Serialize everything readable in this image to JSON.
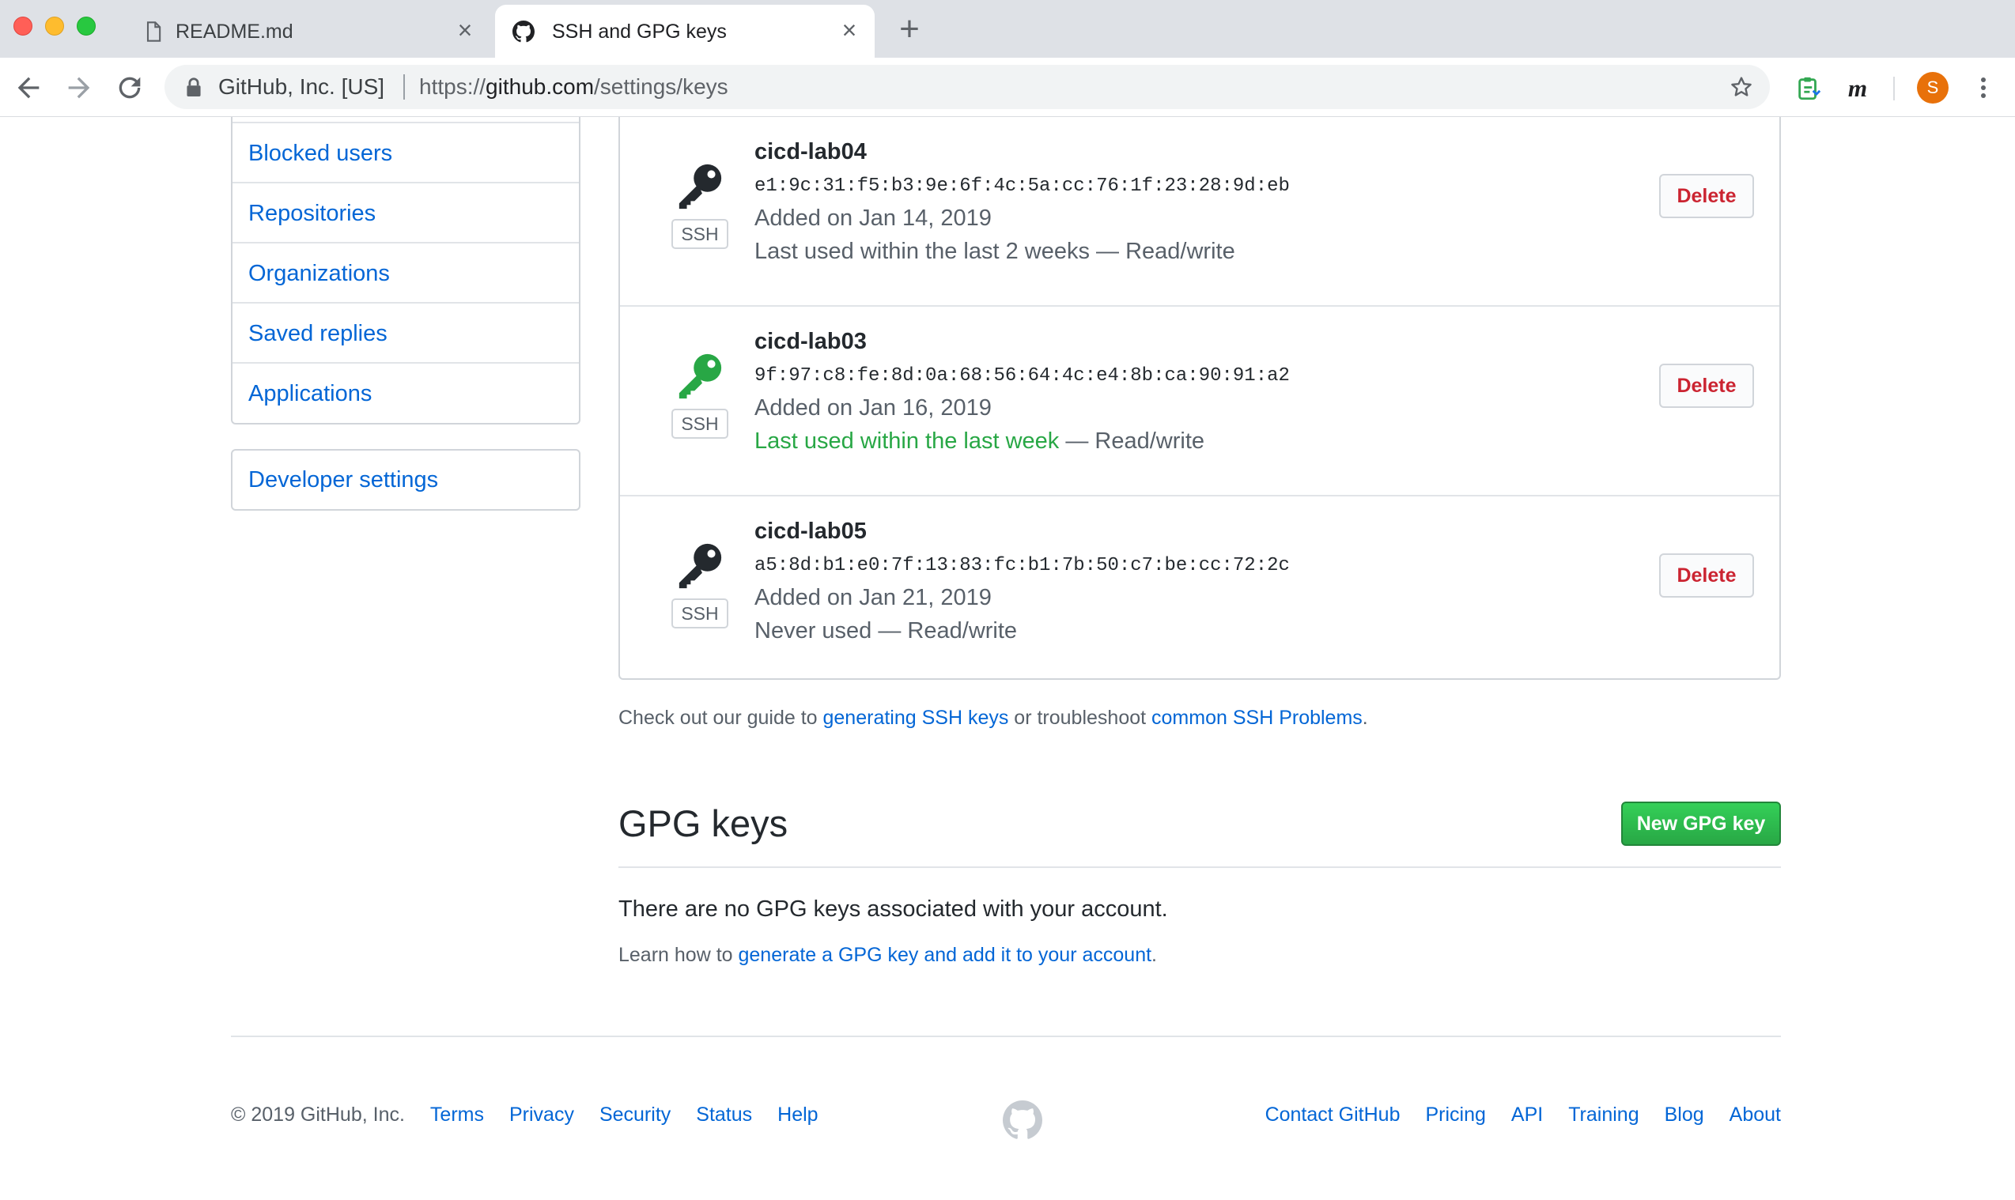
{
  "browser": {
    "tabs": [
      {
        "title": "README.md",
        "icon": "document-icon",
        "active": false
      },
      {
        "title": "SSH and GPG keys",
        "icon": "github-icon",
        "active": true
      }
    ],
    "omnibox": {
      "site_name": "GitHub, Inc. [US]",
      "url_scheme": "https://",
      "url_host": "github.com",
      "url_path": "/settings/keys"
    },
    "profile_initial": "S"
  },
  "sidebar": {
    "items": [
      {
        "label": "Blocked users"
      },
      {
        "label": "Repositories"
      },
      {
        "label": "Organizations"
      },
      {
        "label": "Saved replies"
      },
      {
        "label": "Applications"
      }
    ],
    "developer_settings": "Developer settings"
  },
  "ssh_keys": [
    {
      "title": "cicd-lab04",
      "fingerprint": "e1:9c:31:f5:b3:9e:6f:4c:5a:cc:76:1f:23:28:9d:eb",
      "added": "Added on Jan 14, 2019",
      "last_used": "Last used within the last 2 weeks",
      "last_used_recent": false,
      "access": "— Read/write",
      "badge": "SSH",
      "delete_label": "Delete",
      "key_color": "#24292e"
    },
    {
      "title": "cicd-lab03",
      "fingerprint": "9f:97:c8:fe:8d:0a:68:56:64:4c:e4:8b:ca:90:91:a2",
      "added": "Added on Jan 16, 2019",
      "last_used": "Last used within the last week",
      "last_used_recent": true,
      "access": "— Read/write",
      "badge": "SSH",
      "delete_label": "Delete",
      "key_color": "#28a745"
    },
    {
      "title": "cicd-lab05",
      "fingerprint": "a5:8d:b1:e0:7f:13:83:fc:b1:7b:50:c7:be:cc:72:2c",
      "added": "Added on Jan 21, 2019",
      "last_used": "Never used",
      "last_used_recent": false,
      "access": "— Read/write",
      "badge": "SSH",
      "delete_label": "Delete",
      "key_color": "#24292e"
    }
  ],
  "guide": {
    "prefix": "Check out our guide to ",
    "link1": "generating SSH keys",
    "middle": " or troubleshoot ",
    "link2": "common SSH Problems",
    "suffix": "."
  },
  "gpg": {
    "title": "GPG keys",
    "new_button": "New GPG key",
    "empty_message": "There are no GPG keys associated with your account.",
    "learn_prefix": "Learn how to ",
    "learn_link": "generate a GPG key and add it to your account",
    "learn_suffix": "."
  },
  "footer": {
    "copyright": "© 2019 GitHub, Inc.",
    "left_links": [
      "Terms",
      "Privacy",
      "Security",
      "Status",
      "Help"
    ],
    "right_links": [
      "Contact GitHub",
      "Pricing",
      "API",
      "Training",
      "Blog",
      "About"
    ]
  },
  "colors": {
    "link": "#0366d6",
    "danger": "#cb2431",
    "success": "#28a745",
    "text": "#24292e",
    "muted": "#586069"
  }
}
